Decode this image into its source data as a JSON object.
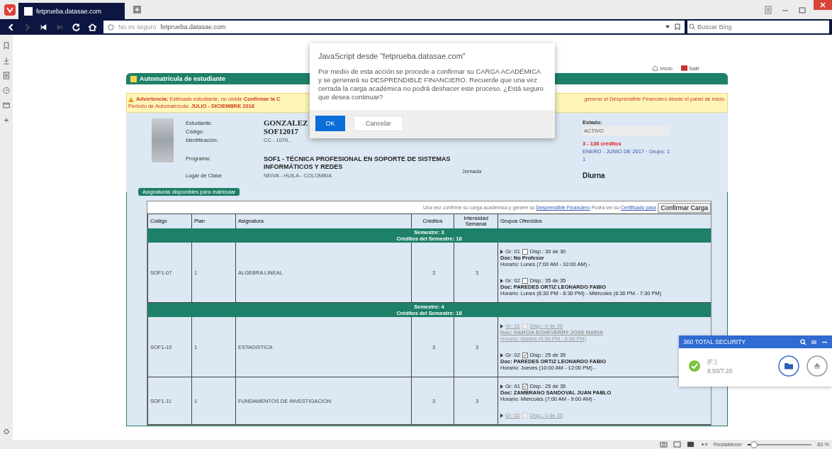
{
  "browser": {
    "tab_title": "fetprueba.datasae.com",
    "url_security": "No es seguro",
    "url": "fetprueba.datasae.com",
    "search_placeholder": "Buscar Bing"
  },
  "page": {
    "links": [
      "Inicio",
      "Salir"
    ],
    "title": "Automatrícula de estudiante",
    "warning": {
      "line_1_start": "**Advertencia:** Estimado estudiante, no olvide **Confirmar la C**",
      "line_1_end": "generar el Desprendible Financiero desde el panel de inicio.",
      "line_2": "Periodo de Automatrícula: **JULIO - DICIEMBRE 2018**"
    },
    "student": {
      "fields": [
        {
          "label": "Estudiante:",
          "value": "GONZALEZ",
          "kind": "big"
        },
        {
          "label": "Código:",
          "value": "SOF12017",
          "kind": "big"
        },
        {
          "label": "Identificación:",
          "value": "CC - 1076...",
          "kind": "small"
        },
        {
          "label": "Programa:",
          "value": "SOF1 - TÉCNICA PROFESIONAL EN SOPORTE DE SISTEMAS INFORMÁTICOS Y REDES",
          "kind": "program"
        },
        {
          "label": "Lugar de Clase",
          "value": "NEIVA - HUILA - COLOMBIA",
          "kind": "small"
        }
      ],
      "status_label": "Estado:",
      "status": "ACTIVO",
      "credits": "3 - 136 créditos",
      "period": "ENERO - JUNIO DE 2017 · Grupo: 1",
      "period_extra": "1",
      "shift_label": "Jornada",
      "shift": "Diurna"
    },
    "subjects": {
      "legend": "Asignaturas disponibles para matricular",
      "note": "Una vez confirme su carga académica y genere su",
      "note_link_1": "Desprendible Financiero",
      "note_mid": "Podrá ver su",
      "note_link_2": "Certificado para",
      "confirm_button": "Confirmar Carga",
      "columns": [
        "Código",
        "Plan",
        "Asignatura",
        "Créditos",
        "Intensidad Semanal",
        "Grupos Ofrecidos"
      ],
      "semesters": [
        {
          "title": "Semestre: 3",
          "credits": "Créditos del Semestre: 18",
          "rows": [
            {
              "code": "SOF1-07",
              "plan": "1",
              "subject": "ALGEBRA LINEAL",
              "credits": "3",
              "intensity": "3",
              "groups": [
                {
                  "group": "Gr: 01",
                  "checked": false,
                  "disabled": false,
                  "availability": "Disp.: 30 de 30",
                  "teacher": "Doc: No Profesor",
                  "schedule": "Horario: Lunes (7:00 AM - 10:00 AM) -"
                },
                {
                  "group": "Gr: 02",
                  "checked": false,
                  "disabled": false,
                  "availability": "Disp.: 35 de 35",
                  "teacher": "Doc: PAREDES ORTIZ LEONARDO FABIO",
                  "schedule": "Horario: Lunes (6:30 PM - 8:30 PM) - Miércoles (6:30 PM - 7:30 PM)"
                }
              ]
            }
          ]
        },
        {
          "title": "Semestre: 4",
          "credits": "Créditos del Semestre: 18",
          "rows": [
            {
              "code": "SOF1-10",
              "plan": "1",
              "subject": "ESTADISTICA",
              "credits": "3",
              "intensity": "3",
              "groups": [
                {
                  "group": "Gr: 01",
                  "checked": false,
                  "disabled": true,
                  "availability": "Disp.: 0 de 35",
                  "teacher": "Doc: GARCIA ECHEVERRY JOSE MARIA",
                  "schedule": "Horario: Martes (6:30 PM - 8:30 PM)"
                },
                {
                  "group": "Gr: 02",
                  "checked": true,
                  "disabled": false,
                  "availability": "Disp.: 25 de 35",
                  "teacher": "Doc: PAREDES ORTIZ LEONARDO FABIO",
                  "schedule": "Horario: Jueves (10:00 AM - 12:00 PM) -"
                }
              ]
            },
            {
              "code": "SOF1-11",
              "plan": "1",
              "subject": "FUNDAMENTOS DE INVESTIGACION",
              "credits": "3",
              "intensity": "3",
              "groups": [
                {
                  "group": "Gr: 01",
                  "checked": true,
                  "disabled": false,
                  "availability": "Disp.: 25 de 35",
                  "teacher": "Doc: ZAMBRANO SANDOVAL JUAN PABLO",
                  "schedule": "Horario: Miércoles (7:00 AM - 9:00 AM) -"
                },
                {
                  "group": "Gr: 02",
                  "checked": false,
                  "disabled": true,
                  "availability": "Disp.: 0 de 35"
                }
              ]
            }
          ]
        }
      ]
    }
  },
  "dialog": {
    "title": "JavaScript desde \"fetprueba.datasae.com\"",
    "message": "Por medio de esta acción se procede a confirmar su CARGA ACADÉMICA y se generará su DESPRENDIBLE FINANCIERO. Recuerde que una vez cerrada la carga académica no podrá deshacer este proceso. ¿Está seguro que desea continuar?",
    "buttons": [
      {
        "label": "OK",
        "primary": true
      },
      {
        "label": "Cancelar",
        "primary": false
      }
    ]
  },
  "notification": {
    "title": "360 TOTAL SECURITY",
    "drive": "(F:)",
    "size": "8.50/7.20"
  },
  "status_bar": {
    "reset": "Restablecer",
    "zoom": "83 %",
    "level": 0.1
  }
}
